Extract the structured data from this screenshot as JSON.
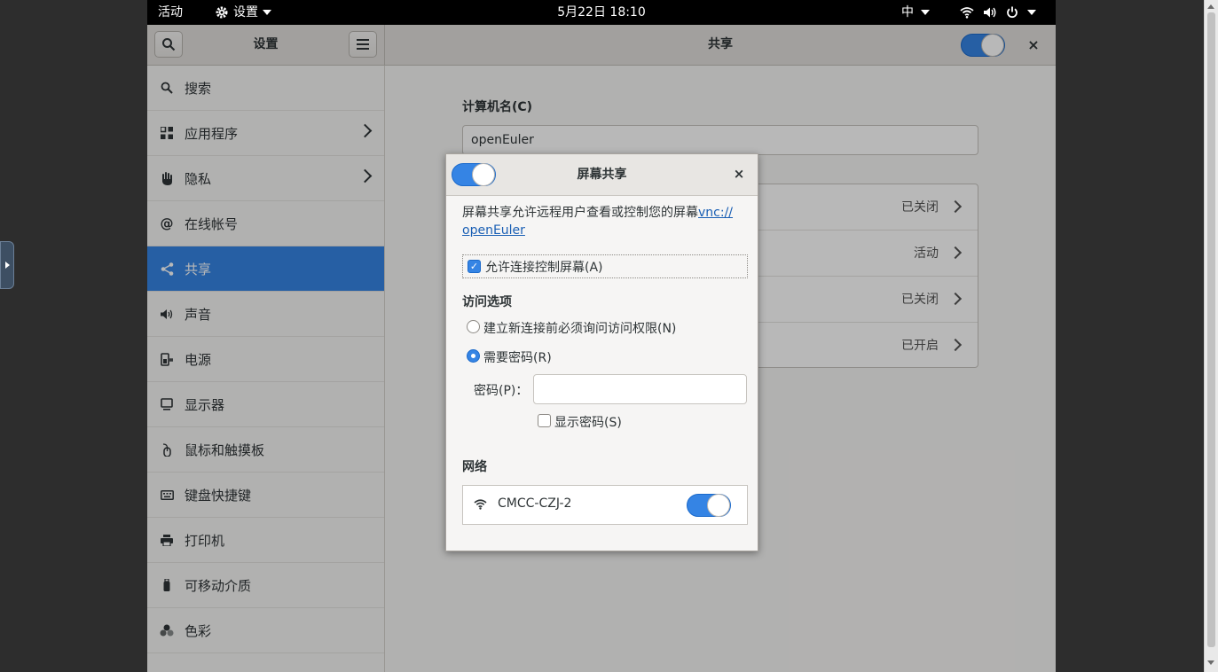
{
  "topbar": {
    "activities": "活动",
    "app_menu": "设置",
    "clock": "5月22日 18:10",
    "ime": "中"
  },
  "header": {
    "sidebar_title": "设置",
    "main_title": "共享",
    "close": "×"
  },
  "sidebar": {
    "items": [
      {
        "label": "搜索",
        "icon": "search-icon"
      },
      {
        "label": "应用程序",
        "icon": "apps-grid-icon"
      },
      {
        "label": "隐私",
        "icon": "hand-icon"
      },
      {
        "label": "在线帐号",
        "icon": "at-icon"
      },
      {
        "label": "共享",
        "icon": "share-icon"
      },
      {
        "label": "声音",
        "icon": "speaker-icon"
      },
      {
        "label": "电源",
        "icon": "power-plug-icon"
      },
      {
        "label": "显示器",
        "icon": "monitor-icon"
      },
      {
        "label": "鼠标和触摸板",
        "icon": "mouse-icon"
      },
      {
        "label": "键盘快捷键",
        "icon": "keyboard-icon"
      },
      {
        "label": "打印机",
        "icon": "printer-icon"
      },
      {
        "label": "可移动介质",
        "icon": "usb-icon"
      },
      {
        "label": "色彩",
        "icon": "color-icon"
      }
    ]
  },
  "main": {
    "computer_name_label": "计算机名(C)",
    "computer_name_value": "openEuler",
    "rows": [
      {
        "status": "已关闭"
      },
      {
        "status": "活动"
      },
      {
        "status": "已关闭"
      },
      {
        "status": "已开启"
      }
    ]
  },
  "dialog": {
    "title": "屏幕共享",
    "close": "×",
    "description": "屏幕共享允许远程用户查看或控制您的屏幕",
    "link": "vnc://openEuler",
    "link_part1": "vnc://",
    "link_part2": "openEuler",
    "allow_control_label": "允许连接控制屏幕(A)",
    "access_options_title": "访问选项",
    "radio_ask_label": "建立新连接前必须询问访问权限(N)",
    "radio_password_label": "需要密码(R)",
    "password_label": "密码(P)：",
    "password_value": "",
    "show_password_label": "显示密码(S)",
    "network_title": "网络",
    "network_name": "CMCC-CZJ-2"
  },
  "colors": {
    "accent": "#3584e4",
    "topbar": "#000000",
    "link": "#1a5fb4"
  }
}
